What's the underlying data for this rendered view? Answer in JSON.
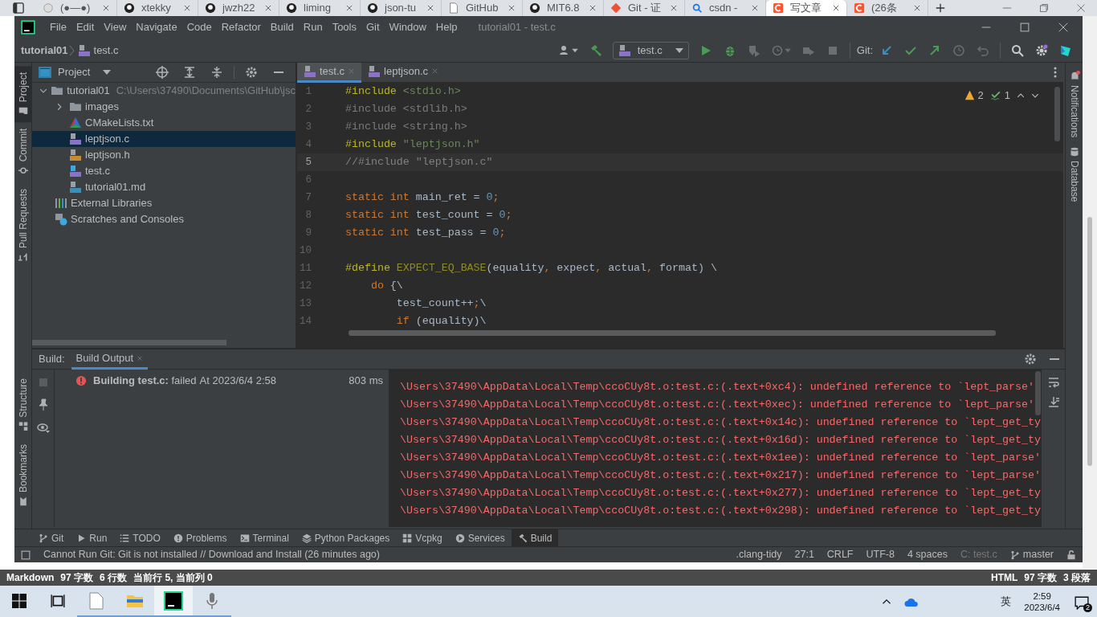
{
  "browser": {
    "tabs": [
      {
        "label": "(●—●)",
        "kind": "generic",
        "selected": false
      },
      {
        "label": "xtekky",
        "kind": "github",
        "selected": false
      },
      {
        "label": "jwzh22",
        "kind": "github",
        "selected": false
      },
      {
        "label": "liming",
        "kind": "github",
        "selected": false
      },
      {
        "label": "json-tu",
        "kind": "github",
        "selected": false
      },
      {
        "label": "GitHub",
        "kind": "doc",
        "selected": false
      },
      {
        "label": "MIT6.8",
        "kind": "github",
        "selected": false
      },
      {
        "label": "Git - 证",
        "kind": "git",
        "selected": false
      },
      {
        "label": "csdn -",
        "kind": "search",
        "selected": false
      },
      {
        "label": "写文章",
        "kind": "csdn",
        "selected": true
      },
      {
        "label": "(26条",
        "kind": "csdn",
        "selected": false
      }
    ],
    "markdown_status": {
      "left": [
        "Markdown",
        "97 字数",
        "6 行数",
        "当前行 5, 当前列 0"
      ],
      "right": [
        "HTML",
        "97 字数",
        "3 段落"
      ]
    }
  },
  "ide": {
    "title": "tutorial01 - test.c",
    "menu": [
      "File",
      "Edit",
      "View",
      "Navigate",
      "Code",
      "Refactor",
      "Build",
      "Run",
      "Tools",
      "Git",
      "Window",
      "Help"
    ],
    "breadcrumb": [
      "tutorial01",
      "test.c"
    ],
    "run_config": "test.c",
    "git_label": "Git:",
    "left_tools": [
      {
        "label": "Project",
        "selected": true
      },
      {
        "label": "Commit",
        "selected": false
      },
      {
        "label": "Pull Requests",
        "selected": false
      }
    ],
    "left_tools_bottom": [
      {
        "label": "Structure",
        "selected": false
      },
      {
        "label": "Bookmarks",
        "selected": false
      }
    ],
    "right_tools": [
      "Notifications",
      "Database"
    ],
    "project": {
      "header": "Project",
      "tree": [
        {
          "label": "tutorial01",
          "note": "C:\\Users\\37490\\Documents\\GitHub\\jsc",
          "kind": "folder",
          "expanded": true,
          "selected": false,
          "children": [
            {
              "label": "images",
              "kind": "folder",
              "expanded": false,
              "selected": false
            },
            {
              "label": "CMakeLists.txt",
              "kind": "cmake",
              "selected": false
            },
            {
              "label": "leptjson.c",
              "kind": "c",
              "selected": true
            },
            {
              "label": "leptjson.h",
              "kind": "h",
              "selected": false
            },
            {
              "label": "test.c",
              "kind": "cmain",
              "selected": false
            },
            {
              "label": "tutorial01.md",
              "kind": "md",
              "selected": false
            }
          ]
        },
        {
          "label": "External Libraries",
          "kind": "library",
          "selected": false
        },
        {
          "label": "Scratches and Consoles",
          "kind": "scratch",
          "selected": false
        }
      ]
    },
    "editor": {
      "tabs": [
        {
          "label": "test.c",
          "selected": true
        },
        {
          "label": "leptjson.c",
          "selected": false
        }
      ],
      "inspections": {
        "warnings": "2",
        "weak_warnings": "1"
      },
      "lines": [
        {
          "number": "1",
          "current": false,
          "tokens": [
            {
              "text": "#include",
              "kind": "directive"
            },
            {
              "text": " <stdio.h>",
              "kind": "string"
            }
          ]
        },
        {
          "number": "2",
          "current": false,
          "tokens": [
            {
              "text": "#include <stdlib.h>",
              "kind": "unused"
            }
          ]
        },
        {
          "number": "3",
          "current": false,
          "tokens": [
            {
              "text": "#include <string.h>",
              "kind": "unused"
            }
          ]
        },
        {
          "number": "4",
          "current": false,
          "tokens": [
            {
              "text": "#include",
              "kind": "directive"
            },
            {
              "text": " \"leptjson.h\"",
              "kind": "string"
            }
          ]
        },
        {
          "number": "5",
          "current": true,
          "tokens": [
            {
              "text": "//#include \"leptjson.c\"",
              "kind": "comment"
            }
          ]
        },
        {
          "number": "6",
          "current": false
        },
        {
          "number": "7",
          "current": false,
          "tokens": [
            {
              "text": "static int",
              "kind": "keyword"
            },
            {
              "text": " main_ret = ",
              "kind": "plain"
            },
            {
              "text": "0",
              "kind": "number"
            },
            {
              "text": ";",
              "kind": "keyword"
            }
          ]
        },
        {
          "number": "8",
          "current": false,
          "tokens": [
            {
              "text": "static int",
              "kind": "keyword"
            },
            {
              "text": " test_count = ",
              "kind": "plain"
            },
            {
              "text": "0",
              "kind": "number"
            },
            {
              "text": ";",
              "kind": "keyword"
            }
          ]
        },
        {
          "number": "9",
          "current": false,
          "tokens": [
            {
              "text": "static int",
              "kind": "keyword"
            },
            {
              "text": " test_pass = ",
              "kind": "plain"
            },
            {
              "text": "0",
              "kind": "number"
            },
            {
              "text": ";",
              "kind": "keyword"
            }
          ]
        },
        {
          "number": "10",
          "current": false
        },
        {
          "number": "11",
          "current": false,
          "tokens": [
            {
              "text": "#define",
              "kind": "directive"
            },
            {
              "text": " EXPECT_EQ_BASE",
              "kind": "macro"
            },
            {
              "text": "(equality",
              "kind": "plain"
            },
            {
              "text": ",",
              "kind": "keyword"
            },
            {
              "text": " expect",
              "kind": "plain"
            },
            {
              "text": ",",
              "kind": "keyword"
            },
            {
              "text": " actual",
              "kind": "plain"
            },
            {
              "text": ",",
              "kind": "keyword"
            },
            {
              "text": " format) \\",
              "kind": "plain"
            }
          ]
        },
        {
          "number": "12",
          "current": false,
          "tokens": [
            {
              "text": "    do",
              "kind": "keyword"
            },
            {
              "text": " {\\",
              "kind": "plain"
            }
          ]
        },
        {
          "number": "13",
          "current": false,
          "tokens": [
            {
              "text": "        test_count++",
              "kind": "plain"
            },
            {
              "text": ";",
              "kind": "keyword"
            },
            {
              "text": "\\",
              "kind": "plain"
            }
          ]
        },
        {
          "number": "14",
          "current": false,
          "tokens": [
            {
              "text": "        if",
              "kind": "keyword"
            },
            {
              "text": " (equality)\\",
              "kind": "plain"
            }
          ]
        }
      ]
    },
    "build": {
      "label": "Build:",
      "tabs": [
        {
          "label": "Build Output",
          "selected": true
        }
      ],
      "tree": [
        {
          "kind": "error",
          "title": "**Building test.c:** failed",
          "time": "At 2023/6/4 2:58",
          "duration": "803 ms"
        }
      ],
      "output": [
        "\\Users\\37490\\AppData\\Local\\Temp\\ccoCUy8t.o:test.c:(.text+0xc4): undefined reference to `lept_parse'",
        "\\Users\\37490\\AppData\\Local\\Temp\\ccoCUy8t.o:test.c:(.text+0xec): undefined reference to `lept_parse'",
        "\\Users\\37490\\AppData\\Local\\Temp\\ccoCUy8t.o:test.c:(.text+0x14c): undefined reference to `lept_get_ty",
        "\\Users\\37490\\AppData\\Local\\Temp\\ccoCUy8t.o:test.c:(.text+0x16d): undefined reference to `lept_get_ty",
        "\\Users\\37490\\AppData\\Local\\Temp\\ccoCUy8t.o:test.c:(.text+0x1ee): undefined reference to `lept_parse'",
        "\\Users\\37490\\AppData\\Local\\Temp\\ccoCUy8t.o:test.c:(.text+0x217): undefined reference to `lept_parse'",
        "\\Users\\37490\\AppData\\Local\\Temp\\ccoCUy8t.o:test.c:(.text+0x277): undefined reference to `lept_get_ty",
        "\\Users\\37490\\AppData\\Local\\Temp\\ccoCUy8t.o:test.c:(.text+0x298): undefined reference to `lept_get_ty"
      ]
    },
    "tool_tabs": [
      {
        "label": "Git",
        "kind": "branch",
        "selected": false
      },
      {
        "label": "Run",
        "kind": "play",
        "selected": false
      },
      {
        "label": "TODO",
        "kind": "list",
        "selected": false
      },
      {
        "label": "Problems",
        "kind": "info",
        "selected": false
      },
      {
        "label": "Terminal",
        "kind": "terminal",
        "selected": false
      },
      {
        "label": "Python Packages",
        "kind": "layers",
        "selected": false
      },
      {
        "label": "Vcpkg",
        "kind": "grid",
        "selected": false
      },
      {
        "label": "Services",
        "kind": "service",
        "selected": false
      },
      {
        "label": "Build",
        "kind": "hammer",
        "selected": true
      }
    ],
    "status_bar": {
      "message": "Cannot Run Git: Git is not installed // Download and Install (26 minutes ago)",
      "items": [
        ".clang-tidy",
        "27:1",
        "CRLF",
        "UTF-8",
        "4 spaces"
      ],
      "context": "C: test.c",
      "branch": "master"
    }
  },
  "taskbar": {
    "apps": [
      {
        "kind": "file",
        "running": true,
        "selected": false
      },
      {
        "kind": "folder",
        "running": true,
        "selected": false
      },
      {
        "kind": "clion",
        "running": true,
        "selected": true
      },
      {
        "kind": "mic",
        "running": true,
        "selected": false
      }
    ],
    "ime": "英",
    "time": "2:59",
    "date": "2023/6/4",
    "notifications": "2"
  }
}
